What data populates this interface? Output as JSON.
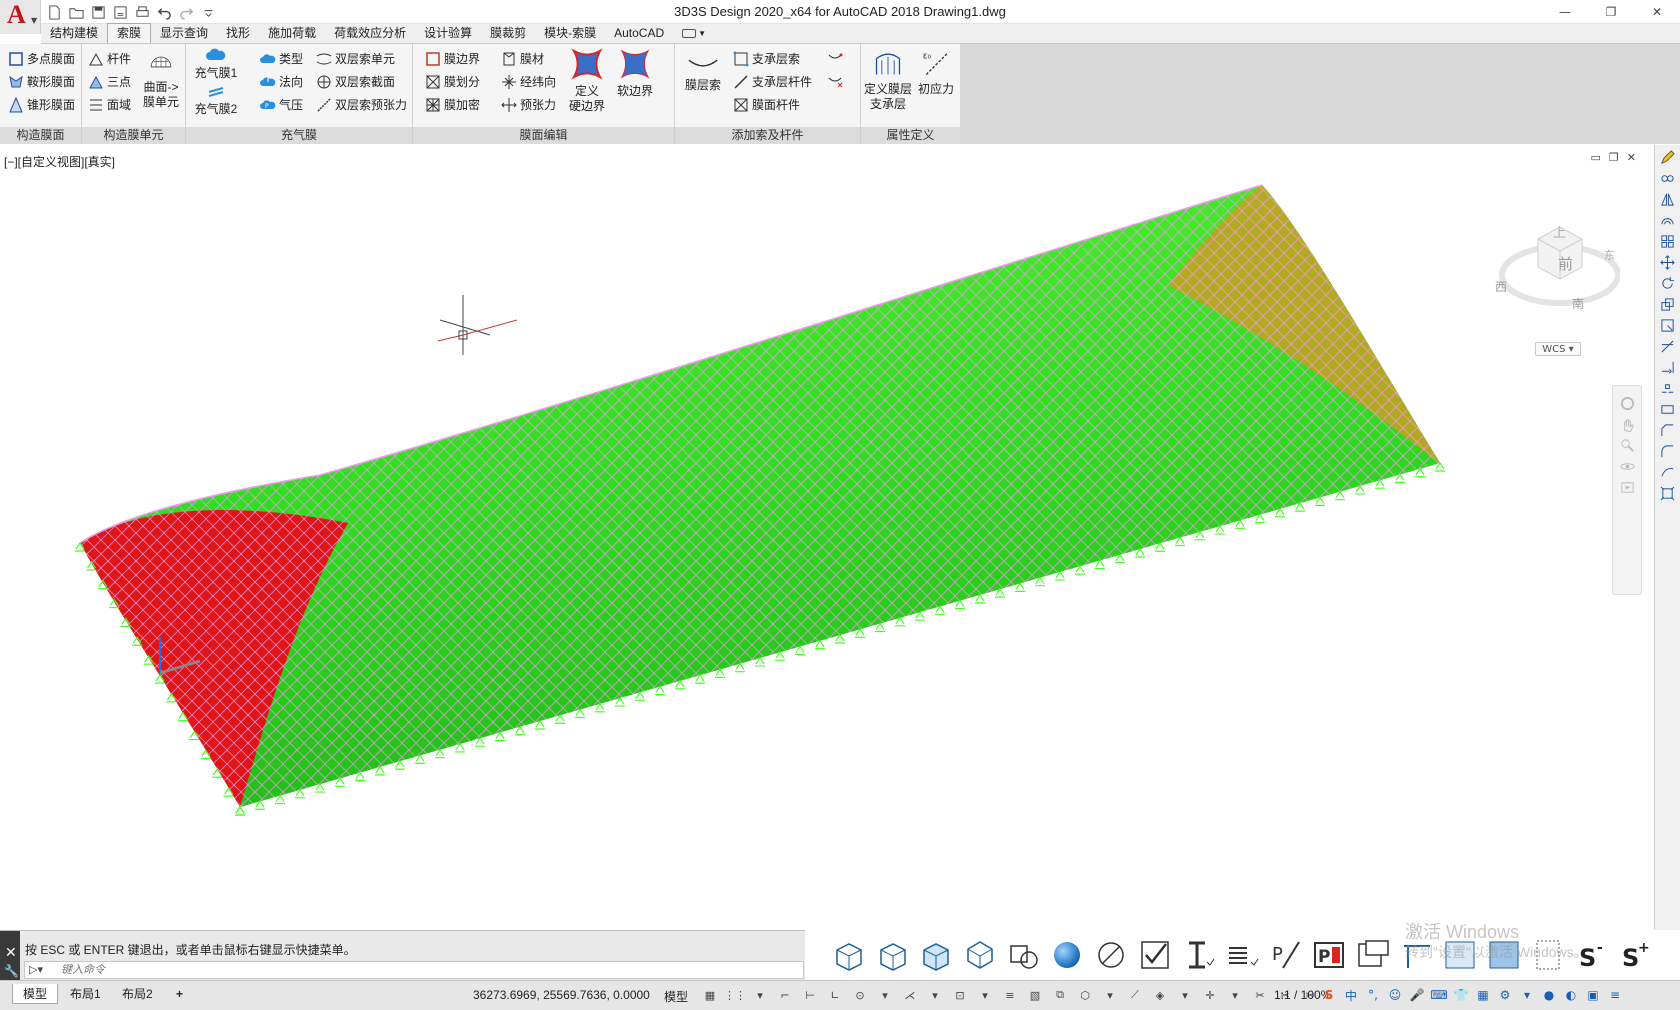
{
  "window": {
    "title": "3D3S Design 2020_x64 for AutoCAD 2018    Drawing1.dwg",
    "app_letter": "A"
  },
  "tabs": [
    {
      "label": "结构建模"
    },
    {
      "label": "索膜"
    },
    {
      "label": "显示查询"
    },
    {
      "label": "找形"
    },
    {
      "label": "施加荷载"
    },
    {
      "label": "荷载效应分析"
    },
    {
      "label": "设计验算"
    },
    {
      "label": "膜裁剪"
    },
    {
      "label": "模块-索膜"
    },
    {
      "label": "AutoCAD"
    }
  ],
  "ribbon": {
    "p1": {
      "title": "构造膜面",
      "items": [
        "多点膜面",
        "鞍形膜面",
        "锥形膜面"
      ]
    },
    "p2": {
      "title": "构造膜单元",
      "items": [
        "杆件",
        "三点",
        "面域"
      ],
      "big": "曲面->\n膜单元"
    },
    "p3": {
      "title": "充气膜",
      "big1": "充气膜1",
      "big2": "充气膜2",
      "items": [
        "类型",
        "法向",
        "气压",
        "双层索单元",
        "双层索截面",
        "双层索预张力"
      ]
    },
    "p4": {
      "title": "膜面编辑",
      "items": [
        "膜边界",
        "膜划分",
        "膜加密",
        "膜材",
        "经纬向",
        "预张力"
      ],
      "big1": "定义\n硬边界",
      "big2": "软边界"
    },
    "p5": {
      "title": "添加索及杆件",
      "big": "膜层索",
      "items": [
        "支承层索",
        "支承层杆件",
        "膜面杆件"
      ]
    },
    "p6": {
      "title": "属性定义",
      "big1": "定义膜层\n支承层",
      "big2": "初应力"
    }
  },
  "viewport": {
    "label": "[−][自定义视图][真实]",
    "wcs": "WCS",
    "cube_face": "前",
    "cube_top": "上",
    "cube_west": "西",
    "cube_east": "东",
    "cube_south": "南"
  },
  "command": {
    "message": "按 ESC 或 ENTER 键退出，或者单击鼠标右键显示快捷菜单。",
    "placeholder": "键入命令"
  },
  "layouts": [
    {
      "label": "模型"
    },
    {
      "label": "布局1"
    },
    {
      "label": "布局2"
    }
  ],
  "status": {
    "coords": "36273.6969, 25569.7636, 0.0000",
    "model": "模型",
    "scale": "1:1 / 100%"
  },
  "watermark": {
    "line1": "激活 Windows",
    "line2": "转到\"设置\"以激活 Windows。"
  },
  "colors": {
    "membrane": "#33dd22",
    "membrane_dark": "#22aa11",
    "red_end": "#e01515",
    "gold_end": "#c8a020",
    "mesh": "#ee99ee"
  }
}
